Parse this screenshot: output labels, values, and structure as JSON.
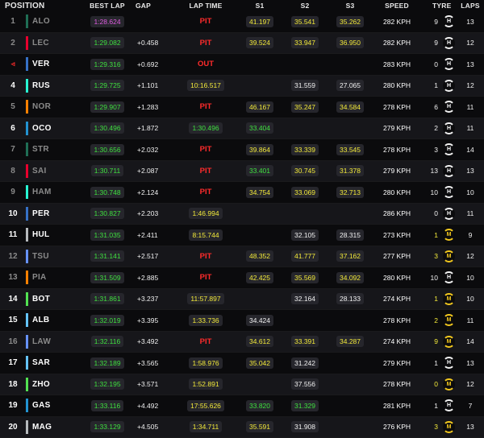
{
  "headers": {
    "position": "POSITION",
    "best_lap": "BEST LAP",
    "gap": "GAP",
    "lap_time": "LAP TIME",
    "s1": "S1",
    "s2": "S2",
    "s3": "S3",
    "speed": "SPEED",
    "tyre": "TYRE",
    "laps": "LAPS"
  },
  "rows": [
    {
      "pos": "1",
      "drv": "ALO",
      "team": "#1f6e55",
      "best": "1:28.624",
      "best_c": "p",
      "gap": "",
      "lt": "PIT",
      "lt_c": "pit",
      "s1": "41.197",
      "s1_c": "y",
      "s2": "35.541",
      "s2_c": "y",
      "s3": "35.262",
      "s3_c": "y",
      "spd": "282 KPH",
      "tn": "9",
      "tn_c": "w",
      "tyre": "H",
      "laps": "13",
      "dim": true
    },
    {
      "pos": "2",
      "drv": "LEC",
      "team": "#e8002d",
      "best": "1:29.082",
      "best_c": "g",
      "gap": "+0.458",
      "lt": "PIT",
      "lt_c": "pit",
      "s1": "39.524",
      "s1_c": "y",
      "s2": "33.947",
      "s2_c": "y",
      "s3": "36.950",
      "s3_c": "y",
      "spd": "282 KPH",
      "tn": "9",
      "tn_c": "w",
      "tyre": "H",
      "laps": "12",
      "dim": true
    },
    {
      "pos": "",
      "drv": "VER",
      "team": "#3671c6",
      "best": "1:29.316",
      "best_c": "g",
      "gap": "+0.692",
      "lt": "OUT",
      "lt_c": "pit",
      "s1": "",
      "s1_c": "w",
      "s2": "",
      "s2_c": "w",
      "s3": "",
      "s3_c": "w",
      "spd": "283 KPH",
      "tn": "0",
      "tn_c": "w",
      "tyre": "H",
      "laps": "13",
      "dim": false,
      "outicon": "◃"
    },
    {
      "pos": "4",
      "drv": "RUS",
      "team": "#27f4d2",
      "best": "1:29.725",
      "best_c": "g",
      "gap": "+1.101",
      "lt": "10:16.517",
      "lt_c": "y",
      "s1": "",
      "s1_c": "w",
      "s2": "31.559",
      "s2_c": "w",
      "s3": "27.065",
      "s3_c": "w",
      "spd": "280 KPH",
      "tn": "1",
      "tn_c": "w",
      "tyre": "H",
      "laps": "12",
      "dim": false
    },
    {
      "pos": "5",
      "drv": "NOR",
      "team": "#ff8000",
      "best": "1:29.907",
      "best_c": "g",
      "gap": "+1.283",
      "lt": "PIT",
      "lt_c": "pit",
      "s1": "46.167",
      "s1_c": "y",
      "s2": "35.247",
      "s2_c": "y",
      "s3": "34.584",
      "s3_c": "y",
      "spd": "278 KPH",
      "tn": "6",
      "tn_c": "w",
      "tyre": "H",
      "laps": "11",
      "dim": true
    },
    {
      "pos": "6",
      "drv": "OCO",
      "team": "#2293d1",
      "best": "1:30.496",
      "best_c": "g",
      "gap": "+1.872",
      "lt": "1:30.496",
      "lt_c": "g",
      "s1": "33.404",
      "s1_c": "g",
      "s2": "",
      "s2_c": "w",
      "s3": "",
      "s3_c": "w",
      "spd": "279 KPH",
      "tn": "2",
      "tn_c": "w",
      "tyre": "H",
      "laps": "11",
      "dim": false
    },
    {
      "pos": "7",
      "drv": "STR",
      "team": "#1f6e55",
      "best": "1:30.656",
      "best_c": "g",
      "gap": "+2.032",
      "lt": "PIT",
      "lt_c": "pit",
      "s1": "39.864",
      "s1_c": "y",
      "s2": "33.339",
      "s2_c": "y",
      "s3": "33.545",
      "s3_c": "y",
      "spd": "278 KPH",
      "tn": "3",
      "tn_c": "w",
      "tyre": "H",
      "laps": "14",
      "dim": true
    },
    {
      "pos": "8",
      "drv": "SAI",
      "team": "#e8002d",
      "best": "1:30.711",
      "best_c": "g",
      "gap": "+2.087",
      "lt": "PIT",
      "lt_c": "pit",
      "s1": "33.401",
      "s1_c": "g",
      "s2": "30.745",
      "s2_c": "y",
      "s3": "31.378",
      "s3_c": "y",
      "spd": "279 KPH",
      "tn": "13",
      "tn_c": "w",
      "tyre": "H",
      "laps": "13",
      "dim": true
    },
    {
      "pos": "9",
      "drv": "HAM",
      "team": "#27f4d2",
      "best": "1:30.748",
      "best_c": "g",
      "gap": "+2.124",
      "lt": "PIT",
      "lt_c": "pit",
      "s1": "34.754",
      "s1_c": "y",
      "s2": "33.069",
      "s2_c": "y",
      "s3": "32.713",
      "s3_c": "y",
      "spd": "280 KPH",
      "tn": "10",
      "tn_c": "w",
      "tyre": "H",
      "laps": "10",
      "dim": true
    },
    {
      "pos": "10",
      "drv": "PER",
      "team": "#3671c6",
      "best": "1:30.827",
      "best_c": "g",
      "gap": "+2.203",
      "lt": "1:46.994",
      "lt_c": "y",
      "s1": "",
      "s1_c": "w",
      "s2": "",
      "s2_c": "w",
      "s3": "",
      "s3_c": "w",
      "spd": "286 KPH",
      "tn": "0",
      "tn_c": "w",
      "tyre": "H",
      "laps": "11",
      "dim": false
    },
    {
      "pos": "11",
      "drv": "HUL",
      "team": "#b6babd",
      "best": "1:31.035",
      "best_c": "g",
      "gap": "+2.411",
      "lt": "8:15.744",
      "lt_c": "y",
      "s1": "",
      "s1_c": "w",
      "s2": "32.105",
      "s2_c": "w",
      "s3": "28.315",
      "s3_c": "w",
      "spd": "273 KPH",
      "tn": "1",
      "tn_c": "y",
      "tyre": "M",
      "laps": "9",
      "dim": false
    },
    {
      "pos": "12",
      "drv": "TSU",
      "team": "#6692ff",
      "best": "1:31.141",
      "best_c": "g",
      "gap": "+2.517",
      "lt": "PIT",
      "lt_c": "pit",
      "s1": "48.352",
      "s1_c": "y",
      "s2": "41.777",
      "s2_c": "y",
      "s3": "37.162",
      "s3_c": "y",
      "spd": "277 KPH",
      "tn": "3",
      "tn_c": "y",
      "tyre": "M",
      "laps": "12",
      "dim": true
    },
    {
      "pos": "13",
      "drv": "PIA",
      "team": "#ff8000",
      "best": "1:31.509",
      "best_c": "g",
      "gap": "+2.885",
      "lt": "PIT",
      "lt_c": "pit",
      "s1": "42.425",
      "s1_c": "y",
      "s2": "35.569",
      "s2_c": "y",
      "s3": "34.092",
      "s3_c": "y",
      "spd": "280 KPH",
      "tn": "10",
      "tn_c": "w",
      "tyre": "H",
      "laps": "10",
      "dim": true
    },
    {
      "pos": "14",
      "drv": "BOT",
      "team": "#52e252",
      "best": "1:31.861",
      "best_c": "g",
      "gap": "+3.237",
      "lt": "11:57.897",
      "lt_c": "y",
      "s1": "",
      "s1_c": "w",
      "s2": "32.164",
      "s2_c": "w",
      "s3": "28.133",
      "s3_c": "w",
      "spd": "274 KPH",
      "tn": "1",
      "tn_c": "y",
      "tyre": "M",
      "laps": "10",
      "dim": false
    },
    {
      "pos": "15",
      "drv": "ALB",
      "team": "#64c4ff",
      "best": "1:32.019",
      "best_c": "g",
      "gap": "+3.395",
      "lt": "1:33.736",
      "lt_c": "y",
      "s1": "34.424",
      "s1_c": "w",
      "s2": "",
      "s2_c": "w",
      "s3": "",
      "s3_c": "w",
      "spd": "278 KPH",
      "tn": "2",
      "tn_c": "y",
      "tyre": "M",
      "laps": "11",
      "dim": false
    },
    {
      "pos": "16",
      "drv": "LAW",
      "team": "#6692ff",
      "best": "1:32.116",
      "best_c": "g",
      "gap": "+3.492",
      "lt": "PIT",
      "lt_c": "pit",
      "s1": "34.612",
      "s1_c": "y",
      "s2": "33.391",
      "s2_c": "y",
      "s3": "34.287",
      "s3_c": "y",
      "spd": "274 KPH",
      "tn": "9",
      "tn_c": "y",
      "tyre": "M",
      "laps": "14",
      "dim": true
    },
    {
      "pos": "17",
      "drv": "SAR",
      "team": "#64c4ff",
      "best": "1:32.189",
      "best_c": "g",
      "gap": "+3.565",
      "lt": "1:58.976",
      "lt_c": "y",
      "s1": "35.042",
      "s1_c": "y",
      "s2": "31.242",
      "s2_c": "w",
      "s3": "",
      "s3_c": "w",
      "spd": "279 KPH",
      "tn": "1",
      "tn_c": "w",
      "tyre": "H",
      "laps": "13",
      "dim": false
    },
    {
      "pos": "18",
      "drv": "ZHO",
      "team": "#52e252",
      "best": "1:32.195",
      "best_c": "g",
      "gap": "+3.571",
      "lt": "1:52.891",
      "lt_c": "y",
      "s1": "",
      "s1_c": "w",
      "s2": "37.556",
      "s2_c": "w",
      "s3": "",
      "s3_c": "w",
      "spd": "278 KPH",
      "tn": "0",
      "tn_c": "y",
      "tyre": "M",
      "laps": "12",
      "dim": false
    },
    {
      "pos": "19",
      "drv": "GAS",
      "team": "#2293d1",
      "best": "1:33.116",
      "best_c": "g",
      "gap": "+4.492",
      "lt": "17:55.626",
      "lt_c": "y",
      "s1": "33.820",
      "s1_c": "g",
      "s2": "31.329",
      "s2_c": "g",
      "s3": "",
      "s3_c": "w",
      "spd": "281 KPH",
      "tn": "1",
      "tn_c": "w",
      "tyre": "H",
      "laps": "7",
      "dim": false
    },
    {
      "pos": "20",
      "drv": "MAG",
      "team": "#b6babd",
      "best": "1:33.129",
      "best_c": "g",
      "gap": "+4.505",
      "lt": "1:34.711",
      "lt_c": "y",
      "s1": "35.591",
      "s1_c": "y",
      "s2": "31.908",
      "s2_c": "w",
      "s3": "",
      "s3_c": "w",
      "spd": "276 KPH",
      "tn": "3",
      "tn_c": "y",
      "tyre": "M",
      "laps": "13",
      "dim": false
    }
  ]
}
